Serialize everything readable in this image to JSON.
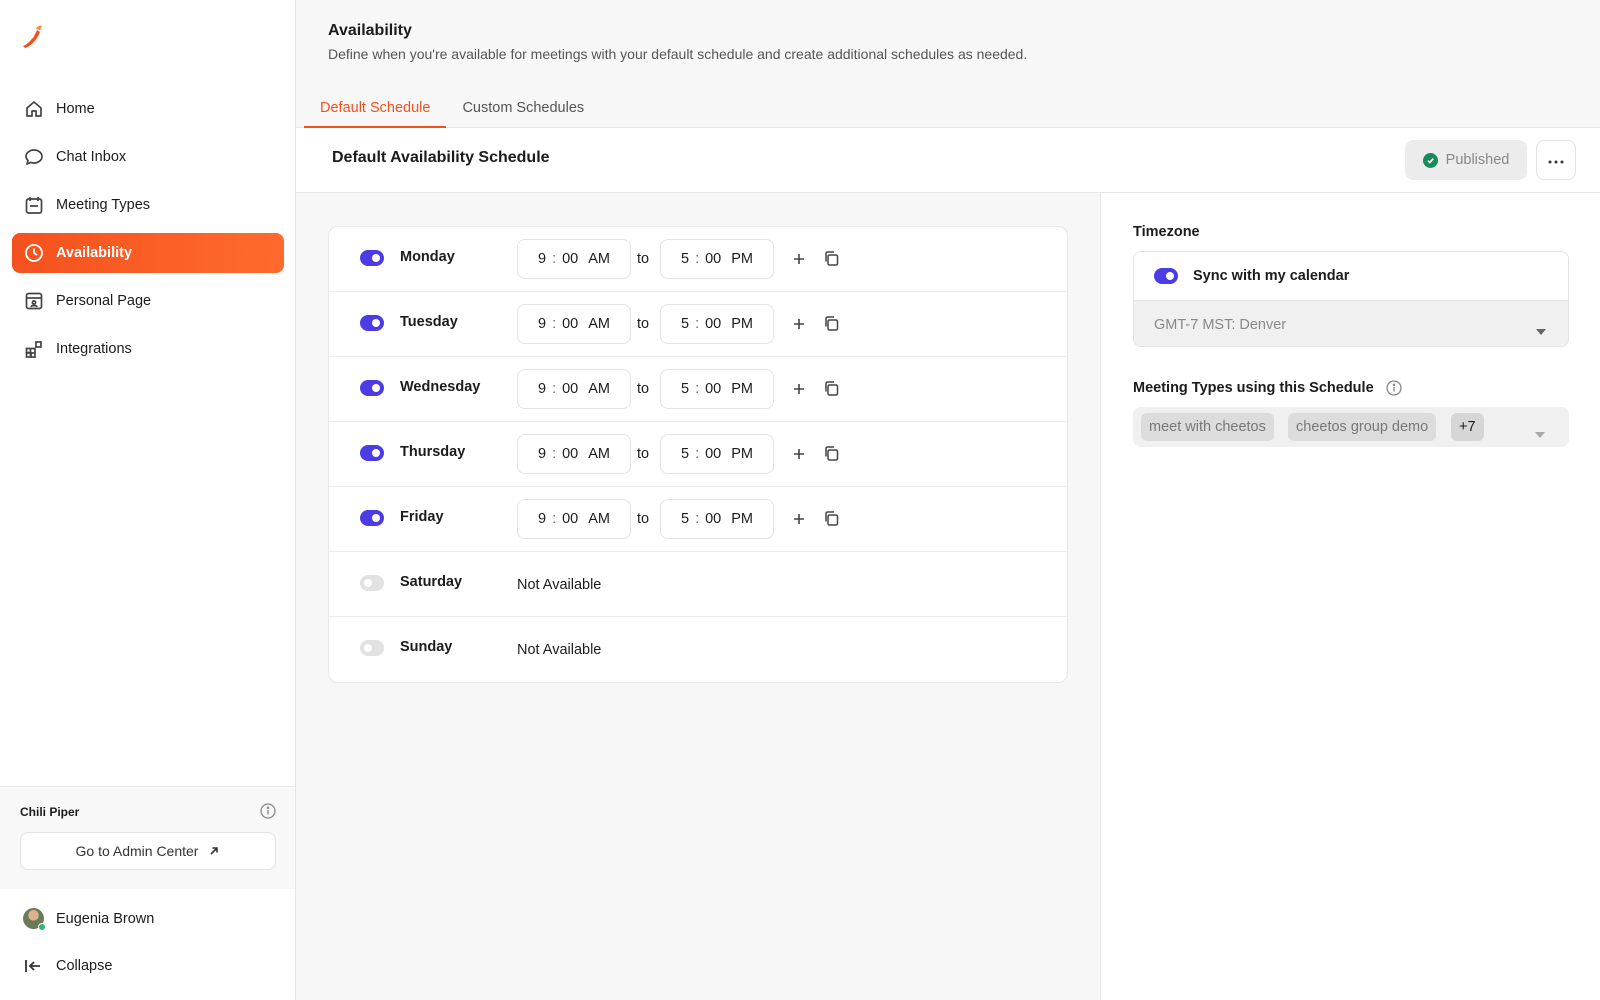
{
  "sidebar": {
    "nav": [
      {
        "label": "Home",
        "icon": "home-icon"
      },
      {
        "label": "Chat Inbox",
        "icon": "chat-bubble-icon"
      },
      {
        "label": "Meeting Types",
        "icon": "calendar-icon"
      },
      {
        "label": "Availability",
        "icon": "clock-icon"
      },
      {
        "label": "Personal Page",
        "icon": "profile-page-icon"
      },
      {
        "label": "Integrations",
        "icon": "integrations-grid-icon"
      }
    ],
    "active": "Availability",
    "org_name": "Chili Piper",
    "admin_button": "Go to Admin Center",
    "user_name": "Eugenia Brown",
    "collapse_label": "Collapse"
  },
  "header": {
    "title": "Availability",
    "subtitle": "Define when you're available for meetings with your default schedule and create additional schedules as needed.",
    "tabs": [
      {
        "label": "Default Schedule",
        "active": true
      },
      {
        "label": "Custom Schedules",
        "active": false
      }
    ]
  },
  "schedule": {
    "title": "Default Availability Schedule",
    "status": "Published",
    "to_label": "to",
    "not_available_label": "Not Available",
    "days": [
      {
        "name": "Monday",
        "enabled": true,
        "start": {
          "h": "9",
          "m": "00",
          "ampm": "AM"
        },
        "end": {
          "h": "5",
          "m": "00",
          "ampm": "PM"
        }
      },
      {
        "name": "Tuesday",
        "enabled": true,
        "start": {
          "h": "9",
          "m": "00",
          "ampm": "AM"
        },
        "end": {
          "h": "5",
          "m": "00",
          "ampm": "PM"
        }
      },
      {
        "name": "Wednesday",
        "enabled": true,
        "start": {
          "h": "9",
          "m": "00",
          "ampm": "AM"
        },
        "end": {
          "h": "5",
          "m": "00",
          "ampm": "PM"
        }
      },
      {
        "name": "Thursday",
        "enabled": true,
        "start": {
          "h": "9",
          "m": "00",
          "ampm": "AM"
        },
        "end": {
          "h": "5",
          "m": "00",
          "ampm": "PM"
        }
      },
      {
        "name": "Friday",
        "enabled": true,
        "start": {
          "h": "9",
          "m": "00",
          "ampm": "AM"
        },
        "end": {
          "h": "5",
          "m": "00",
          "ampm": "PM"
        }
      },
      {
        "name": "Saturday",
        "enabled": false
      },
      {
        "name": "Sunday",
        "enabled": false
      }
    ]
  },
  "timezone": {
    "label": "Timezone",
    "sync_label": "Sync with my calendar",
    "sync_enabled": true,
    "value": "GMT-7  MST: Denver"
  },
  "meeting_types": {
    "label": "Meeting Types using this Schedule",
    "chips": [
      "meet with cheetos",
      "cheetos group demo"
    ],
    "more": "+7"
  },
  "colors": {
    "accent": "#f4511e",
    "toggle_on": "#4b3ce6",
    "published_check": "#1b8a5a"
  }
}
